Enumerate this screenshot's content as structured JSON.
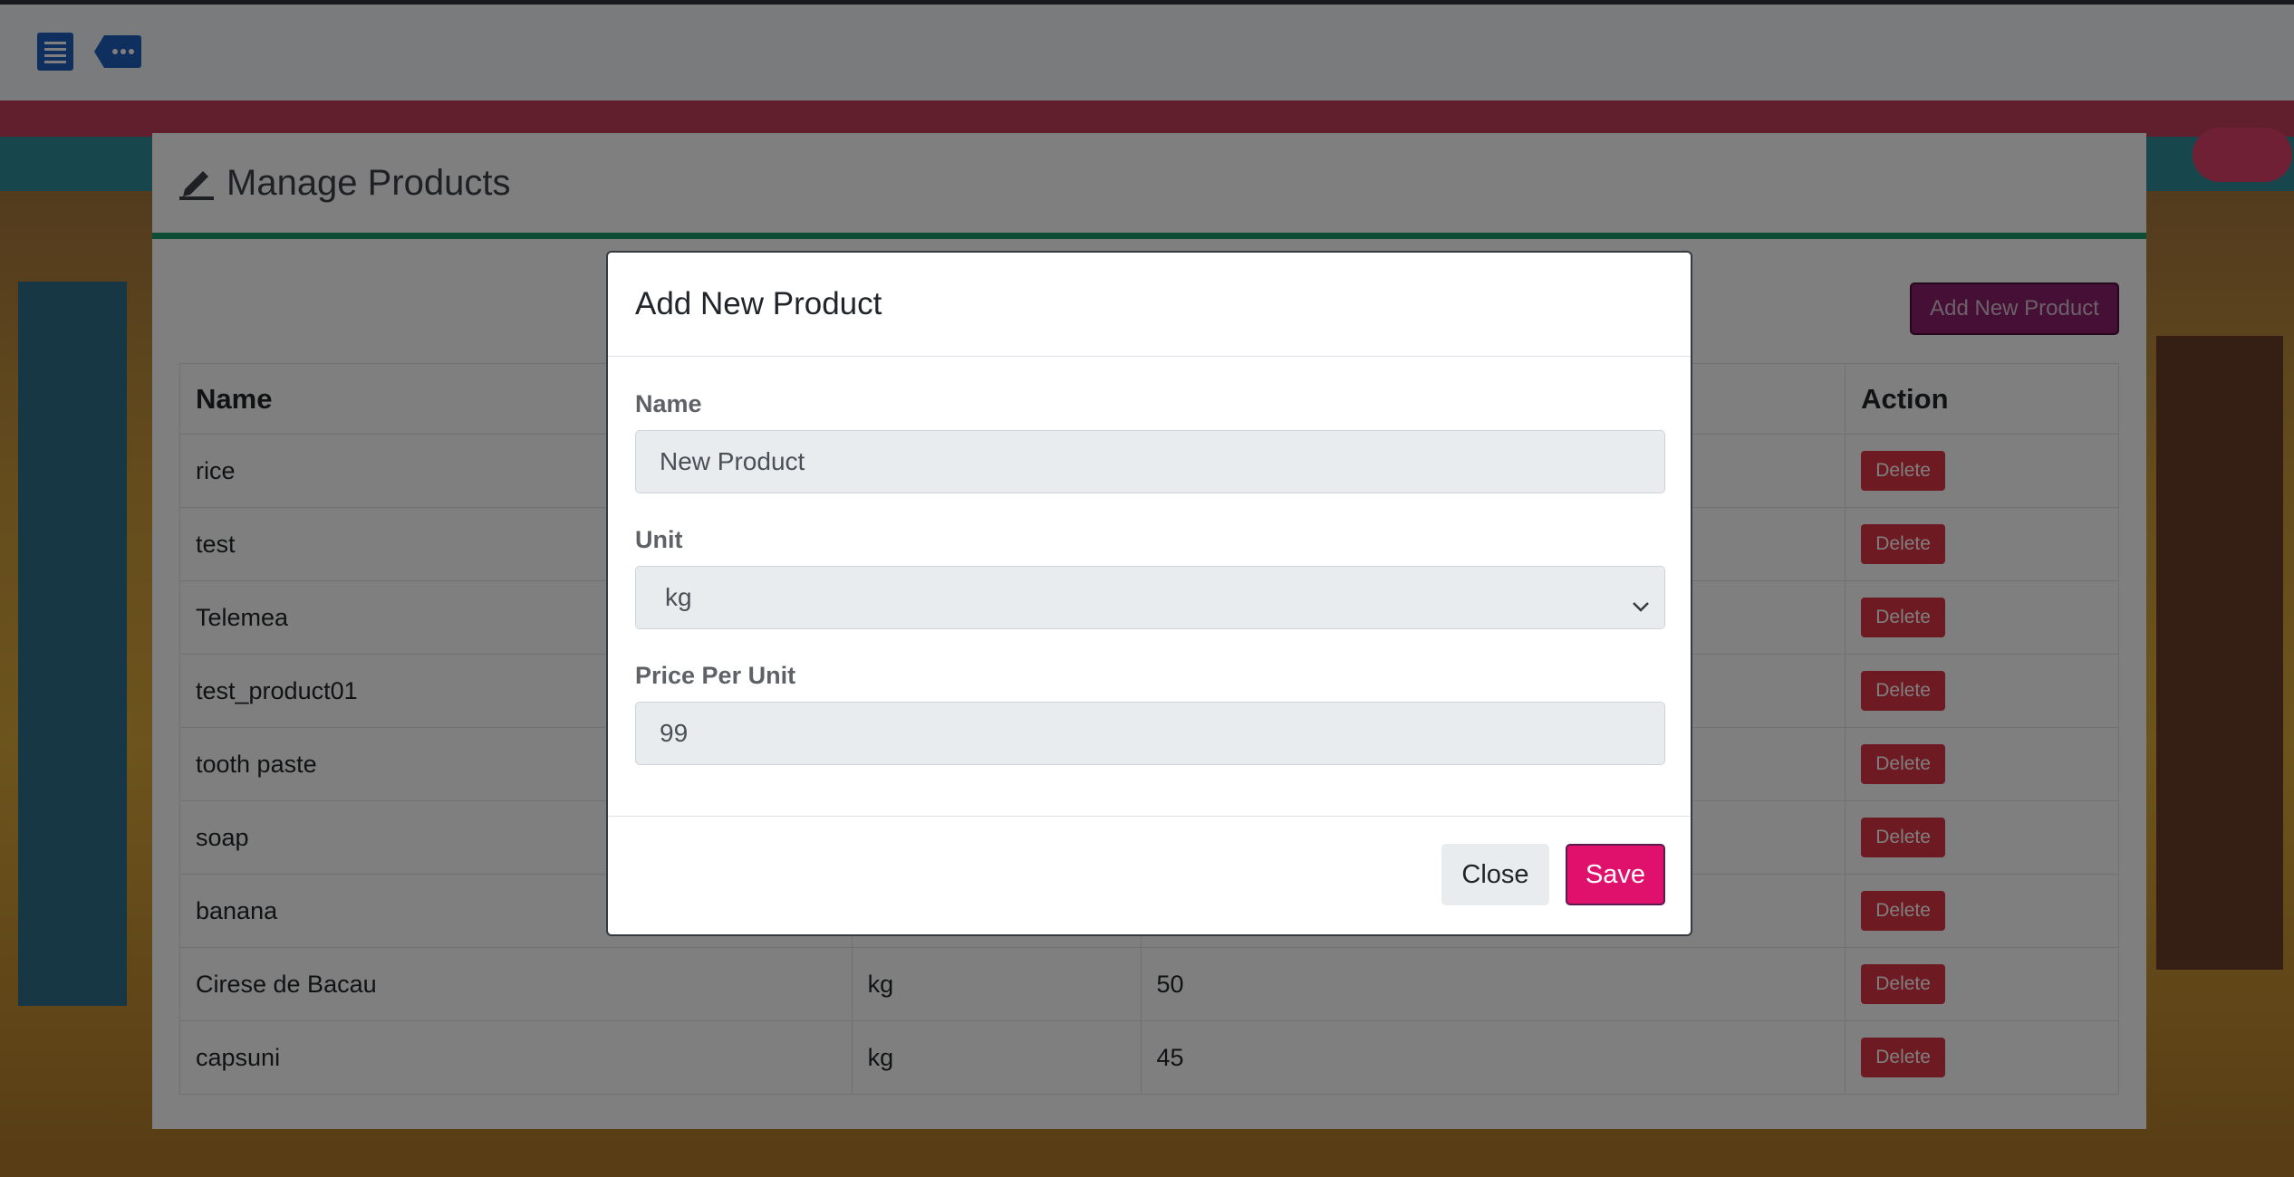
{
  "nav": {
    "menu_icon": "list-icon",
    "more_icon": "more-tag-icon"
  },
  "card": {
    "title": "Manage Products",
    "title_icon": "pencil-icon",
    "add_button": "Add New Product"
  },
  "table": {
    "headers": [
      "Name",
      "",
      "",
      "Action"
    ],
    "rows": [
      {
        "name": "rice",
        "unit": "",
        "price": "",
        "action": "Delete"
      },
      {
        "name": "test",
        "unit": "",
        "price": "",
        "action": "Delete"
      },
      {
        "name": "Telemea",
        "unit": "",
        "price": "",
        "action": "Delete"
      },
      {
        "name": "test_product01",
        "unit": "",
        "price": "",
        "action": "Delete"
      },
      {
        "name": "tooth paste",
        "unit": "",
        "price": "",
        "action": "Delete"
      },
      {
        "name": "soap",
        "unit": "",
        "price": "",
        "action": "Delete"
      },
      {
        "name": "banana",
        "unit": "",
        "price": "",
        "action": "Delete"
      },
      {
        "name": "Cirese de Bacau",
        "unit": "kg",
        "price": "50",
        "action": "Delete"
      },
      {
        "name": "capsuni",
        "unit": "kg",
        "price": "45",
        "action": "Delete"
      }
    ]
  },
  "modal": {
    "title": "Add New Product",
    "name_label": "Name",
    "name_value": "New Product",
    "unit_label": "Unit",
    "unit_value": "kg",
    "price_label": "Price Per Unit",
    "price_value": "99",
    "close_button": "Close",
    "save_button": "Save"
  },
  "colors": {
    "accent_green": "#1c9a6b",
    "add_button": "#8a1f6c",
    "delete_button": "#dc3545",
    "save_button": "#e0106d"
  }
}
